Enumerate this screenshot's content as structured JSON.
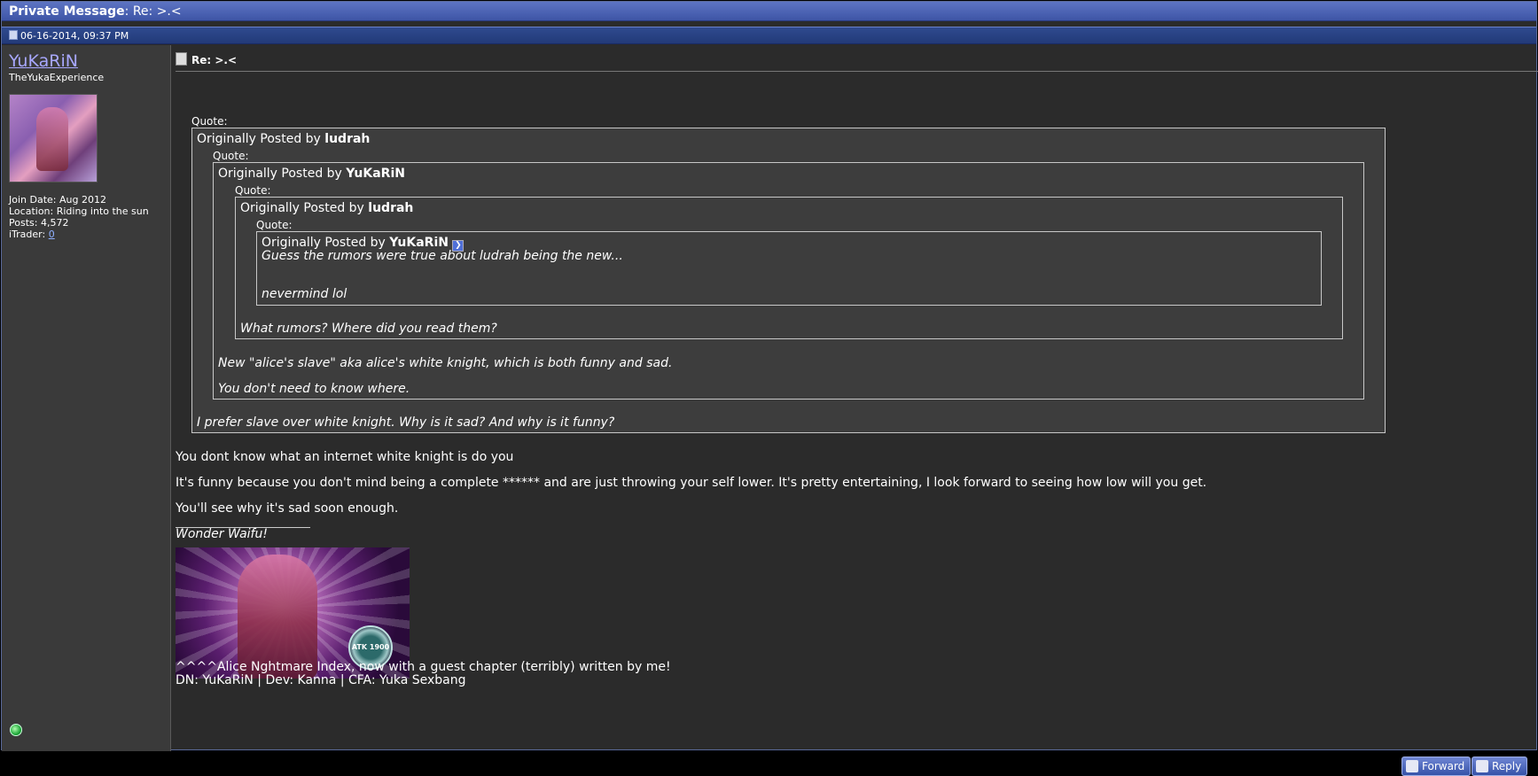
{
  "window": {
    "title_prefix": "Private Message",
    "title_suffix": ": Re: >.<"
  },
  "date": "06-16-2014, 09:37 PM",
  "user": {
    "name": "YuKaRiN",
    "title": "TheYukaExperience",
    "join_date": "Join Date: Aug 2012",
    "location": "Location: Riding into the sun",
    "posts": "Posts: 4,572",
    "itrader_label": "iTrader: ",
    "itrader_value": "0"
  },
  "post": {
    "title": "Re: >.<",
    "quote_label": "Quote:",
    "originally_posted_by": "Originally Posted by",
    "quote1_author": "ludrah",
    "quote2_author": "YuKaRiN",
    "quote3_author": "ludrah",
    "quote4_author": "YuKaRiN",
    "quote4_line1": "Guess the rumors were true about ludrah being the new...",
    "quote4_line2": "nevermind lol",
    "quote3_text": "What rumors? Where did you read them?",
    "quote2_line1": "New \"alice's slave\" aka alice's white knight, which is both funny and sad.",
    "quote2_line2": "You don't need to know where.",
    "quote1_text": "I prefer slave over white knight. Why is it sad? And why is it funny?",
    "body_line1": "You dont know what an internet white knight is do you",
    "body_line2": "It's funny because you don't mind being a complete ****** and are just throwing your self lower. It's pretty entertaining, I look forward to seeing how low will you get.",
    "body_line3": "You'll see why it's sad soon enough."
  },
  "signature": {
    "caption": "Wonder Waifu!",
    "card_badge": "ATK 1900",
    "line1": "^^^^Alice Nghtmare Index, now with a guest chapter (terribly) written by me!",
    "line2": "DN: YuKaRiN | Dev: Kanna | CFA: Yuka Sexbang"
  },
  "buttons": {
    "forward": "Forward",
    "reply": "Reply"
  }
}
